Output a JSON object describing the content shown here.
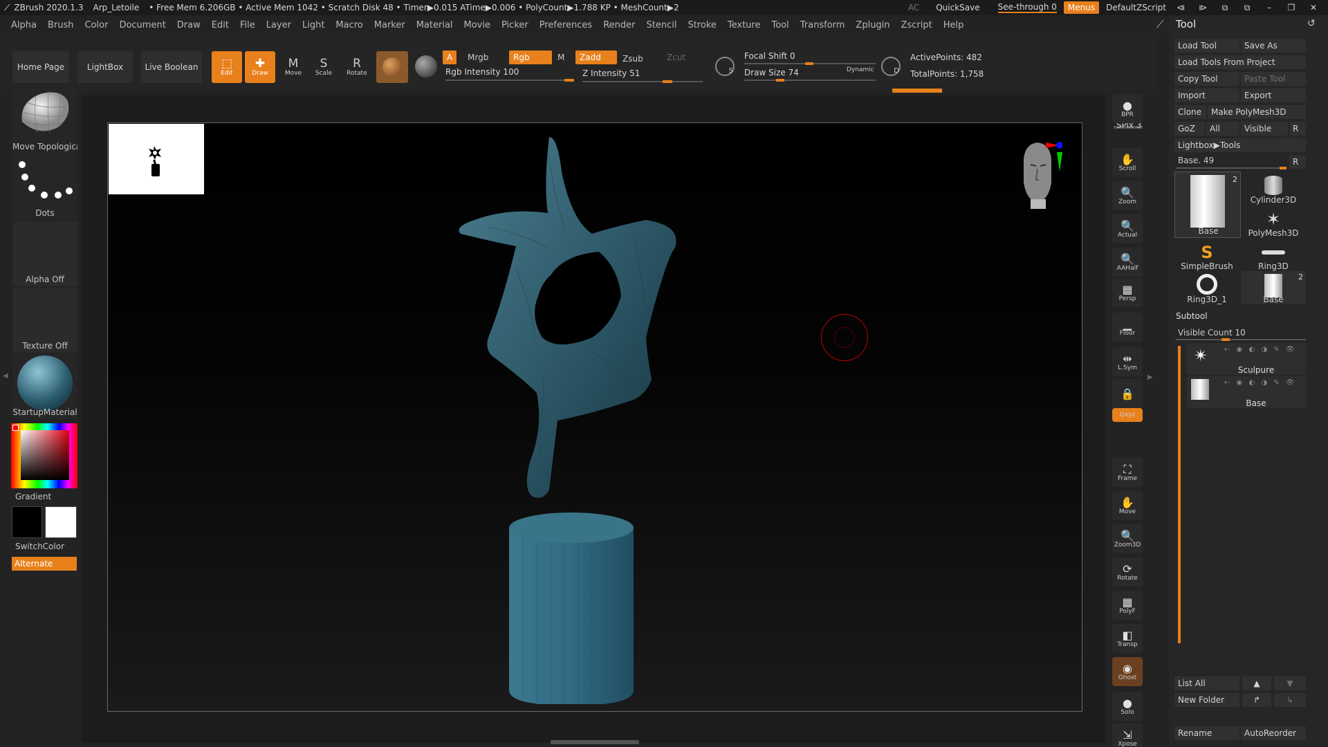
{
  "titlebar": {
    "app": "ZBrush 2020.1.3",
    "doc": "Arp_Letoile",
    "stats": "• Free Mem 6.206GB • Active Mem 1042 • Scratch Disk 48 • Timer▶0.015 ATime▶0.006 • PolyCount▶1.788 KP • MeshCount▶2",
    "ac": "AC",
    "quicksave": "QuickSave",
    "see_through": "See-through  0",
    "menus": "Menus",
    "default_zscript": "DefaultZScript"
  },
  "menubar": [
    "Alpha",
    "Brush",
    "Color",
    "Document",
    "Draw",
    "Edit",
    "File",
    "Layer",
    "Light",
    "Macro",
    "Marker",
    "Material",
    "Movie",
    "Picker",
    "Preferences",
    "Render",
    "Stencil",
    "Stroke",
    "Texture",
    "Tool",
    "Transform",
    "Zplugin",
    "Zscript",
    "Help"
  ],
  "shelf": {
    "home_page": "Home Page",
    "lightbox": "LightBox",
    "live_boolean": "Live Boolean",
    "edit": "Edit",
    "draw": "Draw",
    "move": "Move",
    "scale": "Scale",
    "rotate": "Rotate",
    "a": "A",
    "mrgb": "Mrgb",
    "rgb": "Rgb",
    "m": "M",
    "rgb_intensity": "Rgb Intensity 100",
    "zadd": "Zadd",
    "zsub": "Zsub",
    "zcut": "Zcut",
    "z_intensity": "Z Intensity 51",
    "focal_shift": "Focal Shift 0",
    "draw_size": "Draw Size 74",
    "dynamic": "Dynamic",
    "active_points": "ActivePoints: 482",
    "total_points": "TotalPoints: 1,758",
    "s_label": "S",
    "d_label": "D"
  },
  "left": {
    "brush_label": "Move Topological",
    "stroke_label": "Dots",
    "alpha_label": "Alpha Off",
    "texture_label": "Texture Off",
    "material_label": "StartupMaterial",
    "gradient_label": "Gradient",
    "switchcolor_label": "SwitchColor",
    "alternate_label": "Alternate"
  },
  "right_strip": [
    {
      "name": "bpr",
      "label": "BPR",
      "glyph": "●"
    },
    {
      "name": "scroll",
      "label": "Scroll",
      "glyph": "✋"
    },
    {
      "name": "zoom",
      "label": "Zoom",
      "glyph": "🔍"
    },
    {
      "name": "actual",
      "label": "Actual",
      "glyph": "🔍"
    },
    {
      "name": "aahalf",
      "label": "AAHalf",
      "glyph": "🔍"
    },
    {
      "name": "persp",
      "label": "Persp",
      "glyph": "▦"
    },
    {
      "name": "floor",
      "label": "Floor",
      "glyph": "▁"
    },
    {
      "name": "lsym",
      "label": "L.Sym",
      "glyph": "⇹"
    },
    {
      "name": "lock",
      "label": "",
      "glyph": "🔒"
    },
    {
      "name": "xyz",
      "label": "Qxyz",
      "glyph": ""
    },
    {
      "name": "frame",
      "label": "Frame",
      "glyph": "⛶"
    },
    {
      "name": "move",
      "label": "Move",
      "glyph": "✋"
    },
    {
      "name": "zoom3d",
      "label": "Zoom3D",
      "glyph": "🔍"
    },
    {
      "name": "rotate",
      "label": "Rotate",
      "glyph": "⟳"
    },
    {
      "name": "polyf",
      "label": "PolyF",
      "glyph": "▦"
    },
    {
      "name": "transp",
      "label": "Transp",
      "glyph": "◧"
    },
    {
      "name": "ghost",
      "label": "Ghost",
      "glyph": "◉"
    },
    {
      "name": "solo",
      "label": "Solo",
      "glyph": "●"
    },
    {
      "name": "xpose",
      "label": "Xpose",
      "glyph": "⇲"
    }
  ],
  "spix": "SPix 3",
  "tool": {
    "title": "Tool",
    "load_tool": "Load Tool",
    "save_as": "Save As",
    "load_from_project": "Load Tools From Project",
    "copy_tool": "Copy Tool",
    "paste_tool": "Paste Tool",
    "import": "Import",
    "export": "Export",
    "clone": "Clone",
    "make_polymesh": "Make PolyMesh3D",
    "goz": "GoZ",
    "all": "All",
    "visible": "Visible",
    "r": "R",
    "lightbox_tools": "Lightbox▶Tools",
    "base_slider": "Base. 49",
    "thumbs": [
      {
        "label": "Base",
        "count": "2"
      },
      {
        "label": "Cylinder3D",
        "count": ""
      },
      {
        "label": "PolyMesh3D",
        "count": ""
      },
      {
        "label": "SimpleBrush",
        "count": ""
      },
      {
        "label": "Ring3D",
        "count": ""
      },
      {
        "label": "Ring3D_1",
        "count": ""
      },
      {
        "label": "Base",
        "count": "2"
      }
    ],
    "subtool": "Subtool",
    "visible_count": "Visible Count 10",
    "subtool_items": [
      {
        "label": "Sculpure"
      },
      {
        "label": "Base"
      }
    ],
    "list_all": "List All",
    "new_folder": "New Folder",
    "rename": "Rename",
    "autoreorder": "AutoReorder"
  },
  "colors": {
    "accent": "#e8801c",
    "mesh": "#2f5a6a"
  }
}
